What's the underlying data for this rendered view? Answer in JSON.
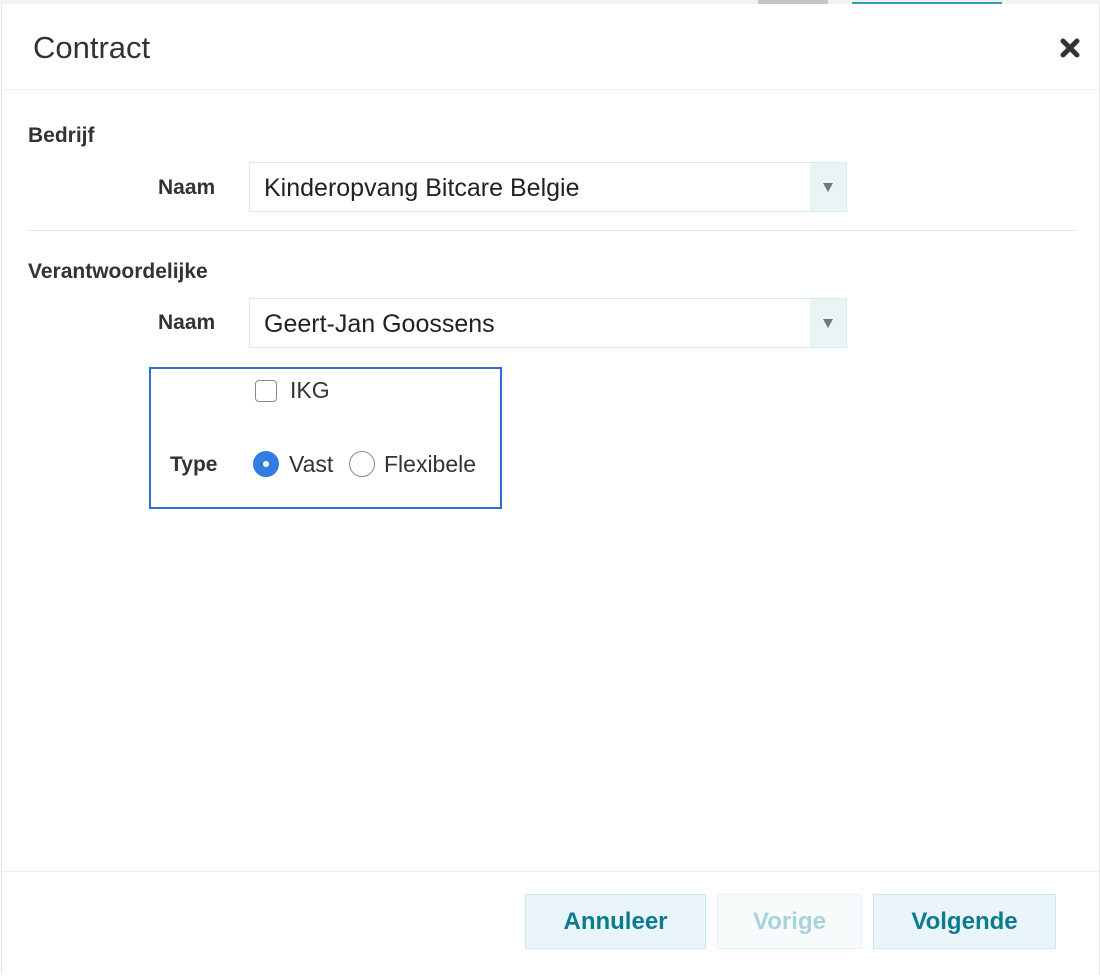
{
  "modal": {
    "title": "Contract",
    "close_icon": "close-icon"
  },
  "company": {
    "section_title": "Bedrijf",
    "name_label": "Naam",
    "name_value": "Kinderopvang Bitcare Belgie"
  },
  "responsible": {
    "section_title": "Verantwoordelijke",
    "name_label": "Naam",
    "name_value": "Geert-Jan Goossens",
    "ikg_label": "IKG",
    "ikg_checked": false,
    "type_label": "Type",
    "type_options": [
      {
        "label": "Vast",
        "selected": true
      },
      {
        "label": "Flexibele",
        "selected": false
      }
    ]
  },
  "footer": {
    "cancel_label": "Annuleer",
    "previous_label": "Vorige",
    "previous_disabled": true,
    "next_label": "Volgende"
  },
  "colors": {
    "button_text": "#0d7b8f",
    "button_bg": "#e9f5f8",
    "radio_selected": "#2f7ee0",
    "focus_outline": "#2e6fd6"
  }
}
